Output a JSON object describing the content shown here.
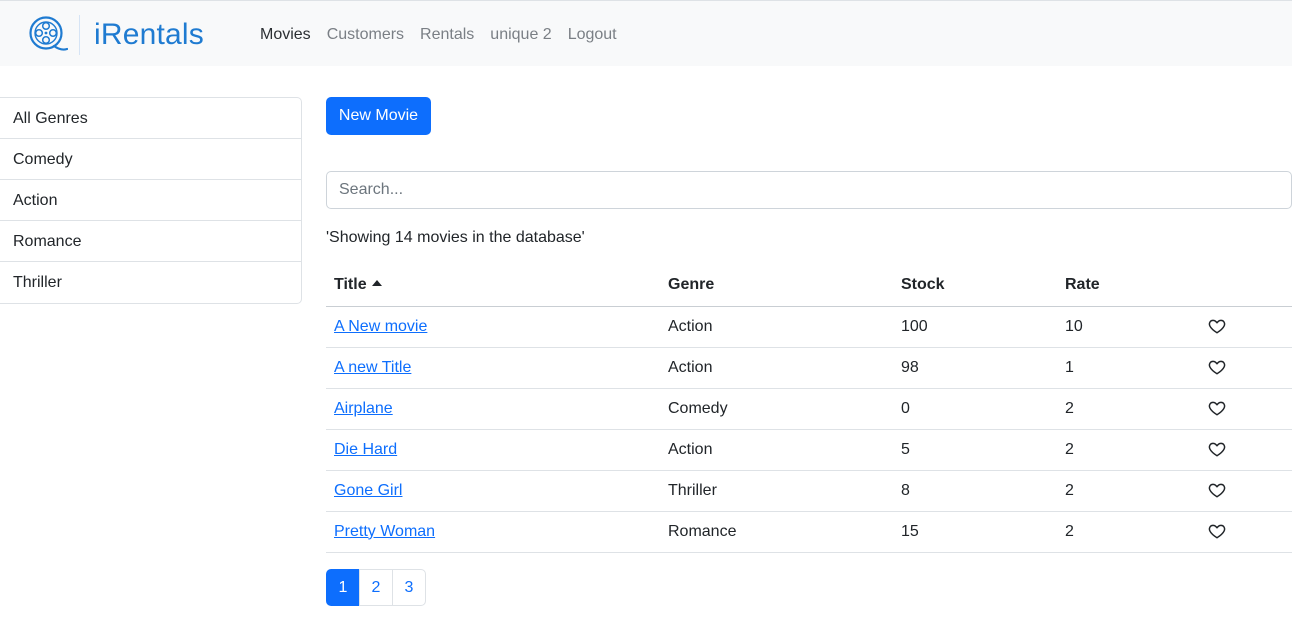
{
  "brand": {
    "name": "iRentals",
    "logo_icon": "film-reel-icon",
    "accent_color": "#1f7bd1"
  },
  "nav": {
    "items": [
      {
        "label": "Movies",
        "active": true
      },
      {
        "label": "Customers",
        "active": false
      },
      {
        "label": "Rentals",
        "active": false
      },
      {
        "label": "unique 2",
        "active": false
      },
      {
        "label": "Logout",
        "active": false
      }
    ]
  },
  "genres": [
    {
      "label": "All Genres"
    },
    {
      "label": "Comedy"
    },
    {
      "label": "Action"
    },
    {
      "label": "Romance"
    },
    {
      "label": "Thriller"
    }
  ],
  "toolbar": {
    "new_movie_label": "New Movie"
  },
  "search": {
    "placeholder": "Search...",
    "value": ""
  },
  "summary": {
    "text": "'Showing 14 movies in the database'"
  },
  "table": {
    "columns": [
      {
        "label": "Title",
        "sorted": "asc"
      },
      {
        "label": "Genre"
      },
      {
        "label": "Stock"
      },
      {
        "label": "Rate"
      },
      {
        "label": ""
      }
    ],
    "rows": [
      {
        "title": "A New movie",
        "genre": "Action",
        "stock": "100",
        "rate": "10",
        "like_icon": "heart-outline-icon"
      },
      {
        "title": "A new Title",
        "genre": "Action",
        "stock": "98",
        "rate": "1",
        "like_icon": "heart-outline-icon"
      },
      {
        "title": "Airplane",
        "genre": "Comedy",
        "stock": "0",
        "rate": "2",
        "like_icon": "heart-outline-icon"
      },
      {
        "title": "Die Hard",
        "genre": "Action",
        "stock": "5",
        "rate": "2",
        "like_icon": "heart-outline-icon"
      },
      {
        "title": "Gone Girl",
        "genre": "Thriller",
        "stock": "8",
        "rate": "2",
        "like_icon": "heart-outline-icon"
      },
      {
        "title": "Pretty Woman",
        "genre": "Romance",
        "stock": "15",
        "rate": "2",
        "like_icon": "heart-outline-icon"
      }
    ]
  },
  "pagination": {
    "pages": [
      "1",
      "2",
      "3"
    ],
    "current": "1",
    "active_color": "#0d6efd"
  }
}
